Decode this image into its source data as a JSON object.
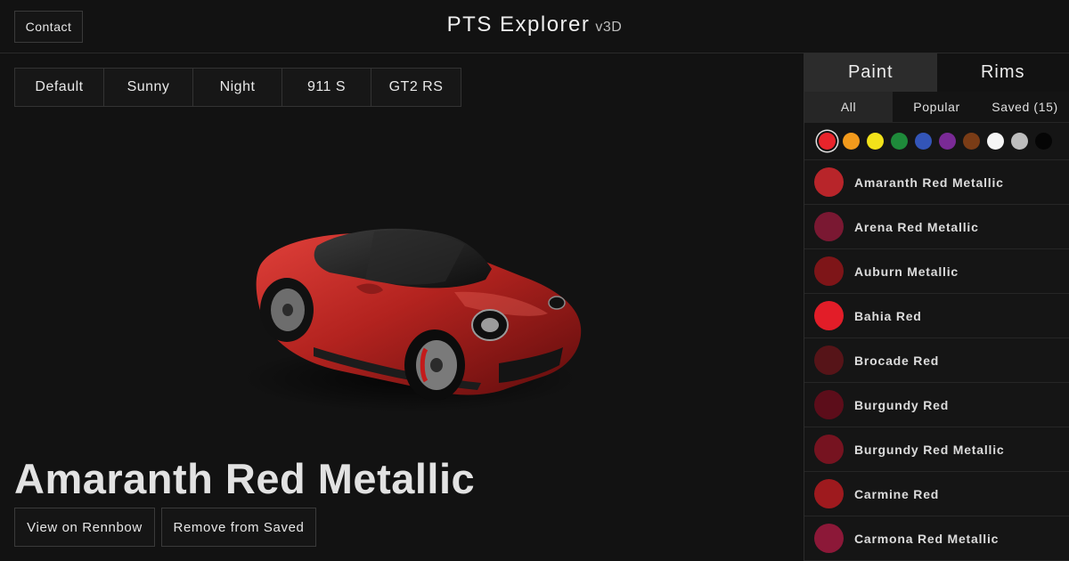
{
  "header": {
    "contact_label": "Contact",
    "title": "PTS Explorer",
    "version": "v3D"
  },
  "segments": [
    {
      "label": "Default",
      "active": true
    },
    {
      "label": "Sunny",
      "active": false
    },
    {
      "label": "Night",
      "active": false
    },
    {
      "label": "911 S",
      "active": true
    },
    {
      "label": "GT2 RS",
      "active": false
    }
  ],
  "car": {
    "selected_name": "Amaranth Red Metallic",
    "body_color": "#b3231f"
  },
  "actions": {
    "view_label": "View on Rennbow",
    "remove_label": "Remove from Saved"
  },
  "sidebar": {
    "main_tabs": [
      {
        "label": "Paint",
        "active": true
      },
      {
        "label": "Rims",
        "active": false
      }
    ],
    "filter_tabs": [
      {
        "label": "All",
        "active": true
      },
      {
        "label": "Popular",
        "active": false
      },
      {
        "label": "Saved (15)",
        "active": false
      }
    ],
    "color_filters": [
      {
        "name": "red",
        "color": "#e8242b",
        "selected": true
      },
      {
        "name": "orange",
        "color": "#f29a1c",
        "selected": false
      },
      {
        "name": "yellow",
        "color": "#f2e21a",
        "selected": false
      },
      {
        "name": "green",
        "color": "#1e8a3a",
        "selected": false
      },
      {
        "name": "blue",
        "color": "#3355b8",
        "selected": false
      },
      {
        "name": "purple",
        "color": "#7a2a96",
        "selected": false
      },
      {
        "name": "brown",
        "color": "#7a3c16",
        "selected": false
      },
      {
        "name": "white",
        "color": "#f5f5f5",
        "selected": false
      },
      {
        "name": "silver",
        "color": "#bdbdbd",
        "selected": false
      },
      {
        "name": "black",
        "color": "#050505",
        "selected": false
      }
    ],
    "paints": [
      {
        "name": "Amaranth Red Metallic",
        "color": "#b8252a"
      },
      {
        "name": "Arena Red Metallic",
        "color": "#7a1832"
      },
      {
        "name": "Auburn Metallic",
        "color": "#7e1518"
      },
      {
        "name": "Bahia Red",
        "color": "#e21d28"
      },
      {
        "name": "Brocade Red",
        "color": "#561418"
      },
      {
        "name": "Burgundy Red",
        "color": "#5c0d1a"
      },
      {
        "name": "Burgundy Red Metallic",
        "color": "#761320"
      },
      {
        "name": "Carmine Red",
        "color": "#9e1a1e"
      },
      {
        "name": "Carmona Red Metallic",
        "color": "#8c1838"
      }
    ]
  }
}
